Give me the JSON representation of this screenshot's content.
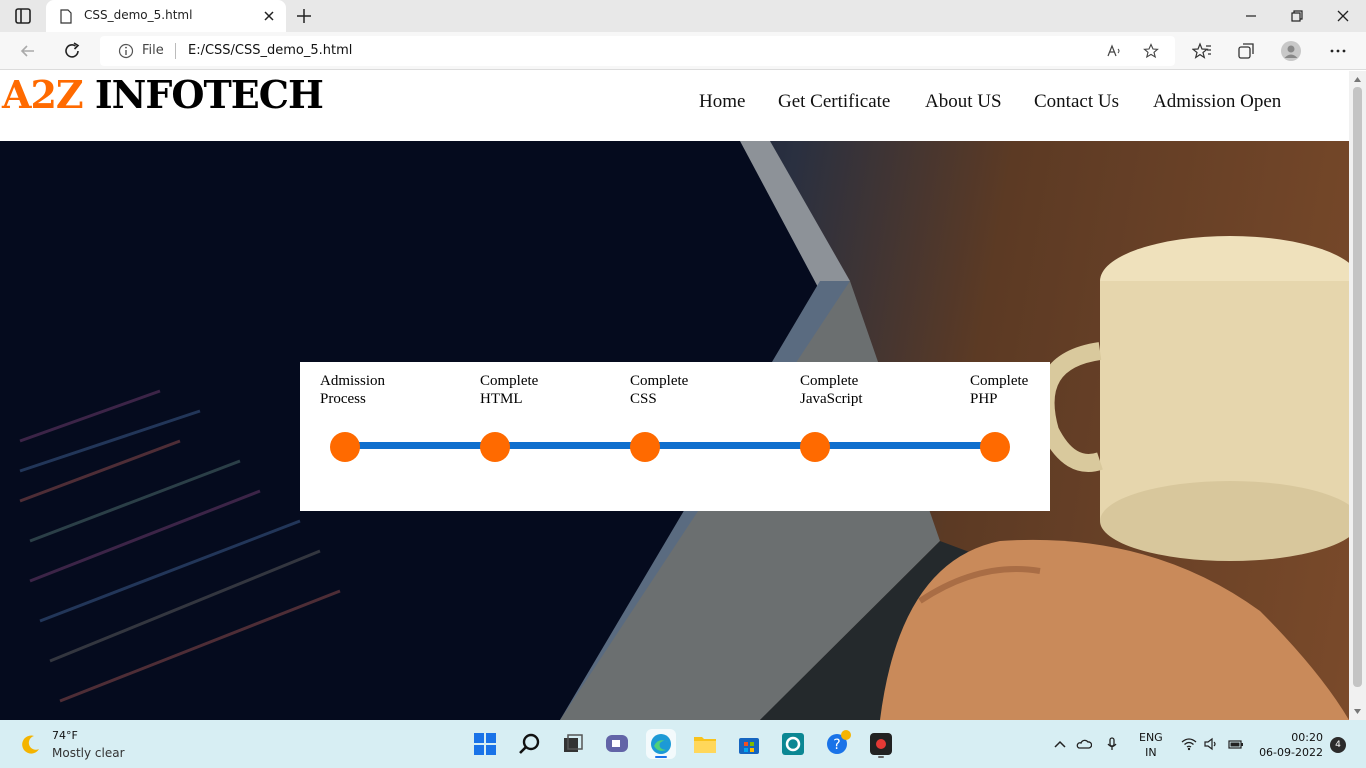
{
  "browser": {
    "tab_title": "CSS_demo_5.html",
    "address_scheme_label": "File",
    "address_url": "E:/CSS/CSS_demo_5.html"
  },
  "page": {
    "logo_accent": "A2Z",
    "logo_rest": " INFOTECH",
    "nav": [
      "Home",
      "Get Certificate",
      "About US",
      "Contact Us",
      "Admission Open"
    ],
    "steps": [
      {
        "line1": "Admission",
        "line2": "Process"
      },
      {
        "line1": "Complete",
        "line2": "HTML"
      },
      {
        "line1": "Complete",
        "line2": "CSS"
      },
      {
        "line1": "Complete",
        "line2": "JavaScript"
      },
      {
        "line1": "Complete",
        "line2": "PHP"
      }
    ],
    "colors": {
      "accent": "#ff6a00",
      "track": "#0f6fce"
    }
  },
  "taskbar": {
    "weather_temp": "74°F",
    "weather_desc": "Mostly clear",
    "lang_line1": "ENG",
    "lang_line2": "IN",
    "time": "00:20",
    "date": "06-09-2022",
    "notification_count": "4"
  }
}
